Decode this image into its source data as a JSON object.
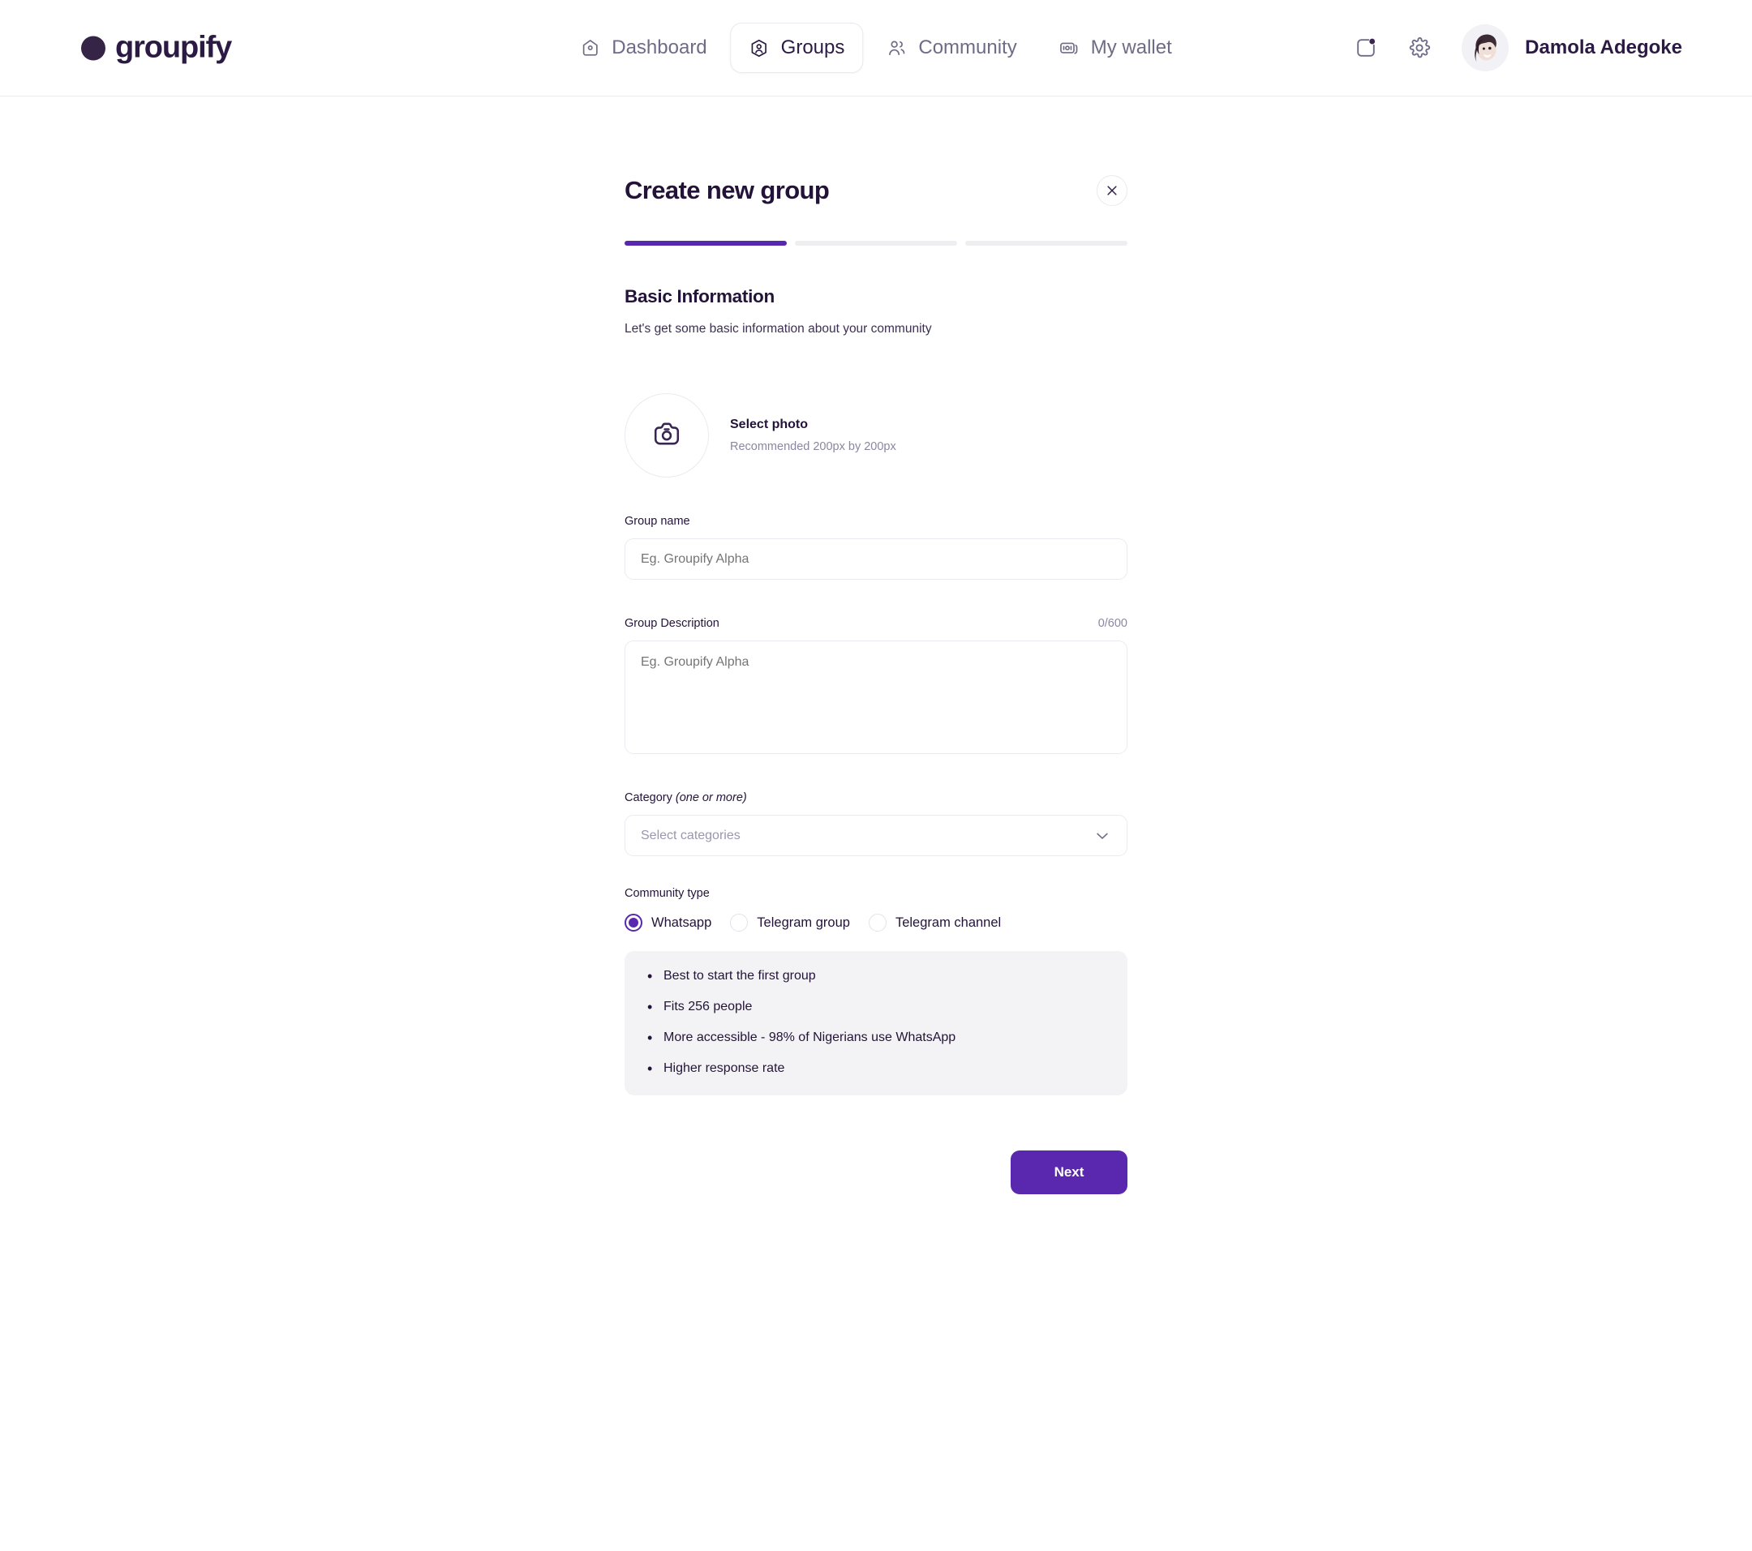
{
  "header": {
    "brand": "groupify",
    "nav": [
      {
        "label": "Dashboard",
        "icon": "home-icon",
        "active": false
      },
      {
        "label": "Groups",
        "icon": "group-hexagon-icon",
        "active": true
      },
      {
        "label": "Community",
        "icon": "people-icon",
        "active": false
      },
      {
        "label": "My wallet",
        "icon": "wallet-icon",
        "active": false
      }
    ],
    "notifications_icon": "notification-icon",
    "settings_icon": "gear-icon",
    "user": {
      "name": "Damola Adegoke",
      "avatar": "user-avatar"
    }
  },
  "modal": {
    "title": "Create new group",
    "close_icon": "close-icon",
    "progress": {
      "total_steps": 3,
      "current_step": 1
    },
    "section_title": "Basic Information",
    "section_subtitle": "Let's get some basic information about your community",
    "photo": {
      "icon": "camera-icon",
      "title": "Select photo",
      "hint": "Recommended 200px by 200px"
    },
    "group_name": {
      "label": "Group name",
      "value": "",
      "placeholder": "Eg. Groupify Alpha"
    },
    "group_description": {
      "label": "Group Description",
      "counter": "0/600",
      "value": "",
      "placeholder": "Eg. Groupify Alpha"
    },
    "category": {
      "label": "Category",
      "label_note": "(one or more)",
      "placeholder": "Select categories",
      "selected": "",
      "chevron_icon": "chevron-down-icon"
    },
    "community_type": {
      "label": "Community type",
      "options": [
        {
          "label": "Whatsapp",
          "selected": true
        },
        {
          "label": "Telegram group",
          "selected": false
        },
        {
          "label": "Telegram channel",
          "selected": false
        }
      ]
    },
    "info_bullets": [
      "Best to start the first group",
      "Fits 256 people",
      "More accessible - 98% of Nigerians use WhatsApp",
      "Higher response rate"
    ],
    "next_label": "Next"
  },
  "colors": {
    "accent": "#5a28ae",
    "text": "#231338",
    "muted": "#8a87a0",
    "border": "#eceaf0",
    "info_bg": "#f3f3f5"
  }
}
